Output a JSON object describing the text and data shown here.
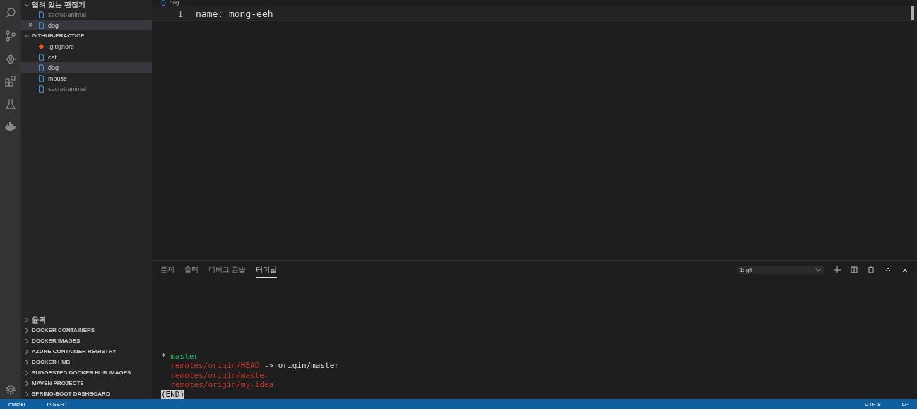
{
  "sidebar": {
    "open_editors": {
      "title": "열려 있는 편집기",
      "expanded": true,
      "items": [
        {
          "name": "secret-animal",
          "dimmed": true,
          "selected": false
        },
        {
          "name": "dog",
          "dimmed": false,
          "selected": true,
          "close": "×"
        }
      ]
    },
    "folder": {
      "title": "GITHUB-PRACTICE",
      "expanded": true,
      "items": [
        {
          "name": ".gitignore",
          "kind": "git",
          "dimmed": false,
          "selected": false
        },
        {
          "name": "cat",
          "kind": "file",
          "dimmed": false,
          "selected": false
        },
        {
          "name": "dog",
          "kind": "file",
          "dimmed": false,
          "selected": true
        },
        {
          "name": "mouse",
          "kind": "file",
          "dimmed": false,
          "selected": false
        },
        {
          "name": "secret-animal",
          "kind": "file",
          "dimmed": true,
          "selected": false
        }
      ]
    },
    "sections": [
      {
        "title": "윤곽",
        "expanded": false
      },
      {
        "title": "DOCKER CONTAINERS",
        "expanded": false
      },
      {
        "title": "DOCKER IMAGES",
        "expanded": false
      },
      {
        "title": "AZURE CONTAINER REGISTRY",
        "expanded": false
      },
      {
        "title": "DOCKER HUB",
        "expanded": false
      },
      {
        "title": "SUGGESTED DOCKER HUB IMAGES",
        "expanded": false
      },
      {
        "title": "MAVEN PROJECTS",
        "expanded": false
      },
      {
        "title": "SPRING-BOOT DASHBOARD",
        "expanded": false
      }
    ]
  },
  "editor": {
    "tab": "dog",
    "lines": [
      {
        "number": "1",
        "text": "name: mong-eeh"
      }
    ]
  },
  "panel": {
    "tabs": [
      {
        "label": "문제",
        "selected": false
      },
      {
        "label": "출력",
        "selected": false
      },
      {
        "label": "디버그 콘솔",
        "selected": false
      },
      {
        "label": "터미널",
        "selected": true
      }
    ],
    "terminal_select": "1: git",
    "terminal": [
      {
        "parts": [
          {
            "text": "* ",
            "kind": "plain"
          },
          {
            "text": "master",
            "kind": "current"
          }
        ]
      },
      {
        "indented": true,
        "parts": [
          {
            "text": "remotes/origin/HEAD",
            "kind": "remote"
          },
          {
            "text": " -> origin/master",
            "kind": "plain"
          }
        ]
      },
      {
        "indented": true,
        "parts": [
          {
            "text": "remotes/origin/master",
            "kind": "remote"
          }
        ]
      },
      {
        "indented": true,
        "parts": [
          {
            "text": "remotes/origin/my-idea",
            "kind": "remote"
          }
        ]
      },
      {
        "parts": [
          {
            "text": "(END)",
            "kind": "pager"
          }
        ]
      }
    ]
  },
  "status_bar": {
    "left": [
      "master",
      "INSERT"
    ],
    "right": [
      "UTF-8",
      "LF"
    ]
  }
}
